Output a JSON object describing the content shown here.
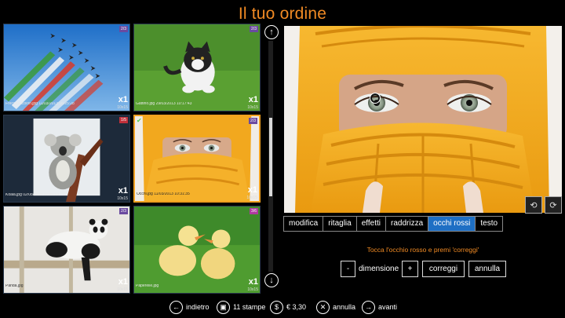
{
  "title": "Il tuo ordine",
  "thumbnails": [
    {
      "filename": "FrecceTricolori.jpg 11/03/2013 16:25:28",
      "qty": "x1",
      "size": "10x15",
      "badge": "2/3",
      "badge_color": "#6a4aa0",
      "checked": false
    },
    {
      "filename": "Gattino.jpg 29/03/2013 10:17:43",
      "qty": "x1",
      "size": "10x15",
      "badge": "2/3",
      "badge_color": "#6a4aa0",
      "checked": false
    },
    {
      "filename": "Koala.jpg 02/08/2010 17:46:53",
      "qty": "x1",
      "size": "10x15",
      "badge": "1/5",
      "badge_color": "#c0303a",
      "checked": false
    },
    {
      "filename": "Occhi.jpg 11/03/2013 10:31:35",
      "qty": "x1",
      "size": "10x15",
      "badge": "2/3",
      "badge_color": "#6a4aa0",
      "checked": true
    },
    {
      "filename": "Panda.jpg",
      "qty": "x1",
      "size": "10x15",
      "badge": "2/3",
      "badge_color": "#6a4aa0",
      "checked": false
    },
    {
      "filename": "Paperelle.jpg",
      "qty": "x1",
      "size": "10x15",
      "badge": "3/6",
      "badge_color": "#b03aa0",
      "checked": false
    }
  ],
  "tabs": [
    "modifica",
    "ritaglia",
    "effetti",
    "raddrizza",
    "occhi rossi",
    "testo"
  ],
  "active_tab": "occhi rossi",
  "hint": "Tocca l'occhio rosso e premi 'correggi'",
  "controls": {
    "minus": "-",
    "dimension_label": "dimensione",
    "plus": "+",
    "fix": "correggi",
    "cancel": "annulla"
  },
  "bottom": {
    "back": "indietro",
    "prints": "11 stampe",
    "price": "€ 3,30",
    "cancel": "annulla",
    "forward": "avanti"
  },
  "icons": {
    "up": "↑",
    "down": "↓",
    "back": "←",
    "forward": "→",
    "cancel": "✕",
    "check": "✔"
  }
}
